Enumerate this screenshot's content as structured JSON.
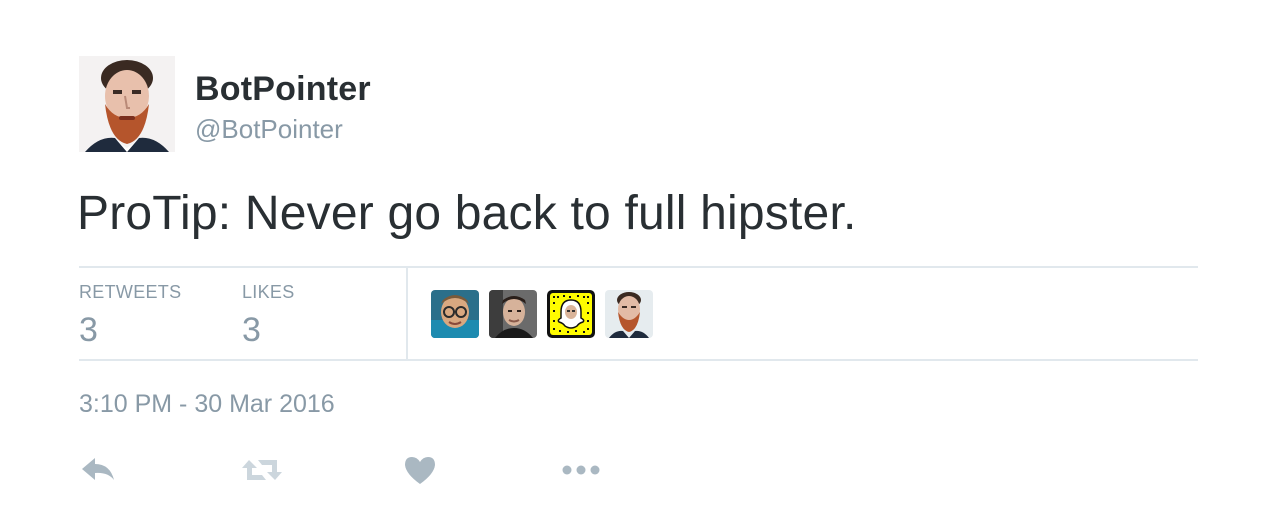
{
  "user": {
    "display_name": "BotPointer",
    "screen_name": "@BotPointer"
  },
  "tweet": {
    "text": "ProTip: Never go back to full hipster.",
    "timestamp": "3:10 PM - 30 Mar 2016"
  },
  "stats": {
    "retweets_label": "RETWEETS",
    "retweets_count": "3",
    "likes_label": "LIKES",
    "likes_count": "3"
  },
  "likers": [
    {
      "icon": "avatar-liker-1"
    },
    {
      "icon": "avatar-liker-2"
    },
    {
      "icon": "avatar-liker-3-snapcode"
    },
    {
      "icon": "avatar-liker-4"
    }
  ],
  "actions": [
    {
      "icon": "reply-icon"
    },
    {
      "icon": "retweet-icon"
    },
    {
      "icon": "like-heart-icon"
    },
    {
      "icon": "more-dots-icon"
    }
  ],
  "colors": {
    "text_primary": "#292f33",
    "text_secondary": "#8899a6",
    "divider": "#e1e8ed",
    "action_icon": "#aab8c2",
    "retweet_icon": "#ccd6dd"
  }
}
